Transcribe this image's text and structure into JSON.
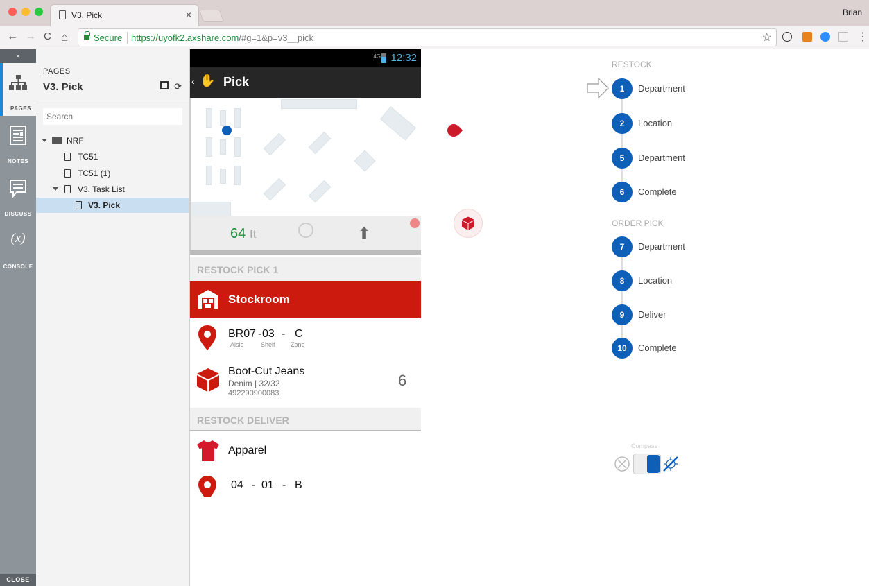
{
  "browser": {
    "tab_title": "V3. Pick",
    "tab_close": "×",
    "user_name": "Brian",
    "secure_label": "Secure",
    "url_host": "https://uyofk2.axshare.com",
    "url_rest": "/#g=1&p=v3__pick",
    "nav": {
      "back": "←",
      "forward": "→",
      "reload": "C",
      "home": "⌂",
      "star": "☆",
      "menu": "⋮"
    }
  },
  "rail": {
    "collapse": "⌄",
    "items": [
      {
        "label": "PAGES",
        "icon": "sitemap-icon"
      },
      {
        "label": "NOTES",
        "icon": "notes-icon"
      },
      {
        "label": "DISCUSS",
        "icon": "discuss-icon"
      },
      {
        "label": "CONSOLE",
        "icon": "variable-icon",
        "glyph": "(x)"
      }
    ],
    "close_label": "CLOSE"
  },
  "sidepanel": {
    "section_label": "PAGES",
    "title": "V3. Pick",
    "search_placeholder": "Search",
    "tree": [
      {
        "label": "NRF",
        "type": "folder",
        "level": 0
      },
      {
        "label": "TC51",
        "type": "page",
        "level": 1
      },
      {
        "label": "TC51 (1)",
        "type": "page",
        "level": 1
      },
      {
        "label": "V3. Task List",
        "type": "page",
        "level": 1
      },
      {
        "label": "V3. Pick",
        "type": "page",
        "level": 2,
        "selected": true
      }
    ]
  },
  "phone": {
    "status": {
      "network": "4G",
      "time": "12:32"
    },
    "appbar": {
      "back": "‹",
      "title": "Pick"
    },
    "map": {
      "distance": "64",
      "unit": "ft"
    },
    "restock_pick": {
      "header": "RESTOCK PICK 1",
      "department": "Stockroom",
      "location": {
        "aisle": "BR07",
        "shelf": "03",
        "zone": "C",
        "aisle_label": "Aisle",
        "shelf_label": "Shelf",
        "zone_label": "Zone",
        "sep": "-"
      },
      "item": {
        "name": "Boot-Cut Jeans",
        "detail": "Denim | 32/32",
        "sku": "492290900083",
        "qty": "6"
      }
    },
    "restock_deliver": {
      "header": "RESTOCK DELIVER",
      "department": "Apparel",
      "location": {
        "aisle": "04",
        "shelf": "01",
        "zone": "B",
        "sep": "-"
      }
    }
  },
  "flow": {
    "restock": {
      "header": "RESTOCK",
      "steps": [
        {
          "num": "1",
          "label": "Department",
          "current": true
        },
        {
          "num": "2",
          "label": "Location"
        },
        {
          "num": "5",
          "label": "Department"
        },
        {
          "num": "6",
          "label": "Complete"
        }
      ]
    },
    "order_pick": {
      "header": "ORDER PICK",
      "steps": [
        {
          "num": "7",
          "label": "Department"
        },
        {
          "num": "8",
          "label": "Location"
        },
        {
          "num": "9",
          "label": "Deliver"
        },
        {
          "num": "10",
          "label": "Complete"
        }
      ]
    }
  },
  "compass": {
    "label": "Compass",
    "enabled": true
  },
  "colors": {
    "accent_blue": "#0d5fb8",
    "brand_red": "#cc1a0e",
    "secure_green": "#1e8a3a"
  }
}
